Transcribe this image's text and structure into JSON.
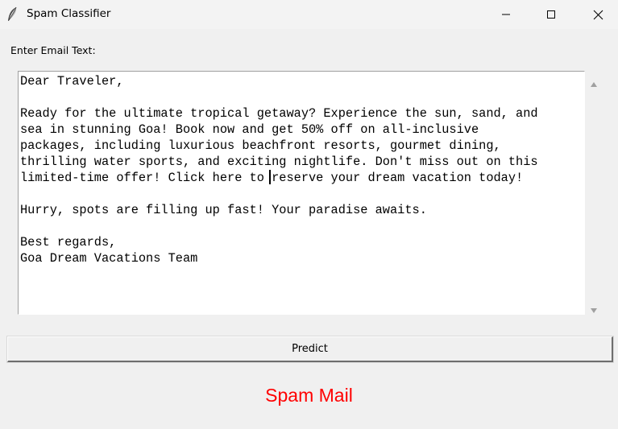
{
  "window": {
    "title": "Spam Classifier",
    "controls": {
      "minimize_icon": "minimize-icon",
      "maximize_icon": "maximize-icon",
      "close_icon": "close-icon"
    }
  },
  "form": {
    "input_label": "Enter Email Text:",
    "email_text": "Dear Traveler,\n\nReady for the ultimate tropical getaway? Experience the sun, sand, and\nsea in stunning Goa! Book now and get 50% off on all-inclusive\npackages, including luxurious beachfront resorts, gourmet dining,\nthrilling water sports, and exciting nightlife. Don't miss out on this\nlimited-time offer! Click here to reserve your dream vacation today!\n\nHurry, spots are filling up fast! Your paradise awaits.\n\nBest regards,\nGoa Dream Vacations Team",
    "predict_label": "Predict"
  },
  "result": {
    "text": "Spam Mail",
    "color": "#ff0000"
  }
}
